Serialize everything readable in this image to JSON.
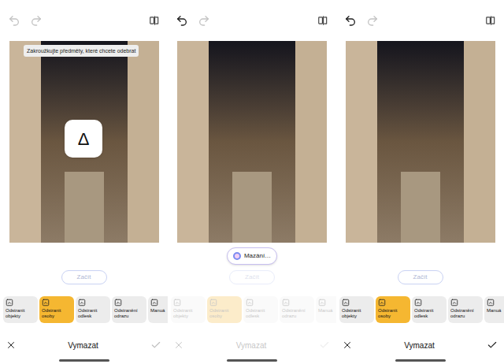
{
  "panels": [
    {
      "undo_enabled": false,
      "redo_enabled": false,
      "tooltip": "Zakroužkujte předměty, které chcete odebrat",
      "overlay_icon": "Δ",
      "start_button": "Začít",
      "controls_disabled": false,
      "tools": [
        {
          "label": "Odstranit objekty",
          "selected": false
        },
        {
          "label": "Odstranit osoby",
          "selected": true
        },
        {
          "label": "Odstranit odlesk",
          "selected": false
        },
        {
          "label": "Odstranění odrazu",
          "selected": false
        },
        {
          "label": "Manuá",
          "selected": false
        }
      ],
      "title": "Vymazat",
      "confirm_enabled": false
    },
    {
      "undo_enabled": true,
      "redo_enabled": false,
      "status_chip": "Mazání…",
      "start_button": "Začít",
      "controls_disabled": true,
      "tools": [
        {
          "label": "Odstranit objekty",
          "selected": false
        },
        {
          "label": "Odstranit osoby",
          "selected": true
        },
        {
          "label": "Odstranit odlesk",
          "selected": false
        },
        {
          "label": "Odstranění odrazu",
          "selected": false
        },
        {
          "label": "Manuá",
          "selected": false
        }
      ],
      "title": "Vymazat",
      "confirm_enabled": false
    },
    {
      "undo_enabled": true,
      "redo_enabled": false,
      "start_button": "Začít",
      "controls_disabled": false,
      "tools": [
        {
          "label": "Odstranit objekty",
          "selected": false
        },
        {
          "label": "Odstranit osoby",
          "selected": true
        },
        {
          "label": "Odstranit odlesk",
          "selected": false
        },
        {
          "label": "Odstranění odrazu",
          "selected": false
        },
        {
          "label": "Manuá",
          "selected": false
        }
      ],
      "title": "Vymazat",
      "confirm_enabled": true
    }
  ]
}
